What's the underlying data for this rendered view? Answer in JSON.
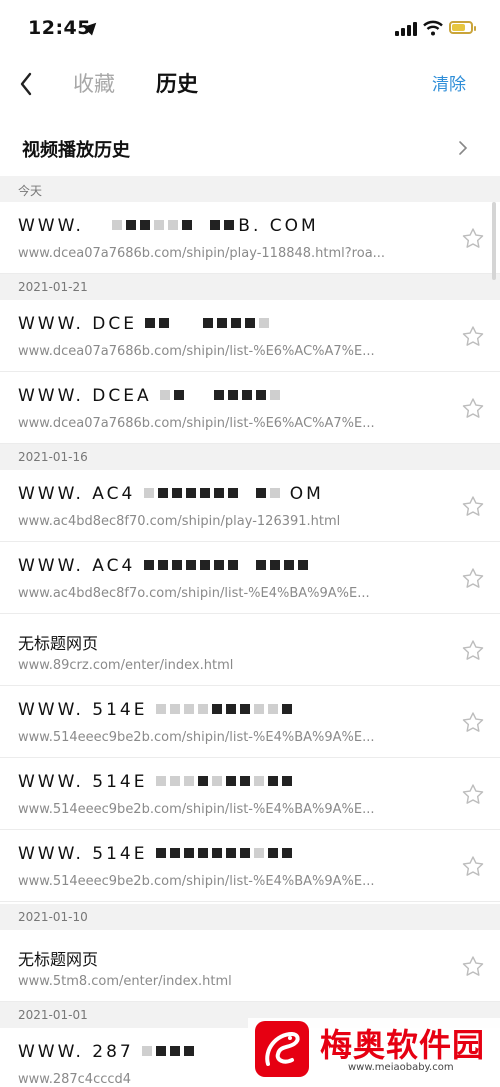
{
  "status": {
    "time": "12:45"
  },
  "nav": {
    "tab_favorites": "收藏",
    "tab_history": "历史",
    "clear": "清除"
  },
  "video_history": {
    "label": "视频播放历史"
  },
  "groups": [
    {
      "date": "今天"
    },
    {
      "date": "2021-01-21"
    },
    {
      "date": "2021-01-16"
    },
    {
      "date": "2021-01-10"
    },
    {
      "date": "2021-01-01"
    }
  ],
  "items": [
    {
      "title": "WWW.",
      "title_suffix": "B. COM",
      "url": "www.dcea07a7686b.com/shipin/play-118848.html?roa..."
    },
    {
      "title": "WWW. DCE",
      "url": "www.dcea07a7686b.com/shipin/list-%E6%AC%A7%E..."
    },
    {
      "title": "WWW. DCEA",
      "url": "www.dcea07a7686b.com/shipin/list-%E6%AC%A7%E..."
    },
    {
      "title": "WWW. AC4",
      "title_suffix": "OM",
      "url": "www.ac4bd8ec8f70.com/shipin/play-126391.html"
    },
    {
      "title": "WWW. AC4",
      "url": "www.ac4bd8ec8f7o.com/shipin/list-%E4%BA%9A%E..."
    },
    {
      "title": "无标题网页",
      "url": "www.89crz.com/enter/index.html"
    },
    {
      "title": "WWW. 514E",
      "url": "www.514eeec9be2b.com/shipin/list-%E4%BA%9A%E..."
    },
    {
      "title": "WWW. 514E",
      "url": "www.514eeec9be2b.com/shipin/list-%E4%BA%9A%E..."
    },
    {
      "title": "WWW. 514E",
      "url": "www.514eeec9be2b.com/shipin/list-%E4%BA%9A%E..."
    },
    {
      "title": "无标题网页",
      "url": "www.5tm8.com/enter/index.html"
    },
    {
      "title": "WWW. 287",
      "url": "www.287c4cccd4"
    }
  ],
  "watermark": {
    "name": "梅奥软件园",
    "url": "www.meiaobaby.com"
  },
  "colors": {
    "accent": "#2f8ed8",
    "date_bg": "#f2f2f2",
    "brand_red": "#e60012"
  },
  "icons": {
    "back": "chevron-left-icon",
    "forward": "chevron-right-icon",
    "favorite": "star-outline-icon"
  }
}
